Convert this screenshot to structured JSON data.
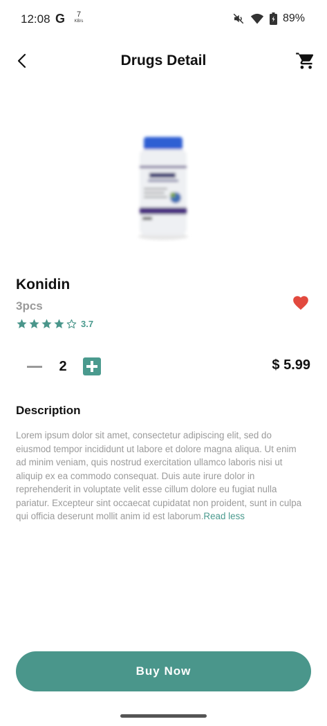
{
  "status_bar": {
    "time": "12:08",
    "g_label": "G",
    "data_speed": "7",
    "data_unit": "KB/s",
    "battery": "89%",
    "icons": [
      "mute-icon",
      "wifi-icon",
      "battery-icon"
    ]
  },
  "header": {
    "title": "Drugs Detail",
    "back_icon": "back-chevron-icon",
    "cart_icon": "cart-icon"
  },
  "product": {
    "name": "Konidin",
    "quantity_label": "3pcs",
    "rating": "3.7",
    "stars_filled": 4,
    "stars_total": 5,
    "favorite": true,
    "quantity": "2",
    "price": "$ 5.99"
  },
  "description": {
    "title": "Description",
    "body": "Lorem ipsum dolor sit amet, consectetur adipiscing elit, sed do eiusmod tempor incididunt ut labore et dolore magna aliqua. Ut enim ad minim veniam, quis nostrud exercitation ullamco laboris nisi ut aliquip ex ea commodo consequat. Duis aute irure dolor in reprehenderit in voluptate velit esse cillum dolore eu fugiat nulla pariatur. Excepteur sint occaecat cupidatat non proident, sunt in culpa qui officia deserunt mollit anim id est laborum.",
    "toggle": "Read less"
  },
  "actions": {
    "buy": "Buy Now"
  },
  "colors": {
    "accent": "#4a968b",
    "heart": "#e2493e",
    "muted_text": "#9a9a9a"
  }
}
